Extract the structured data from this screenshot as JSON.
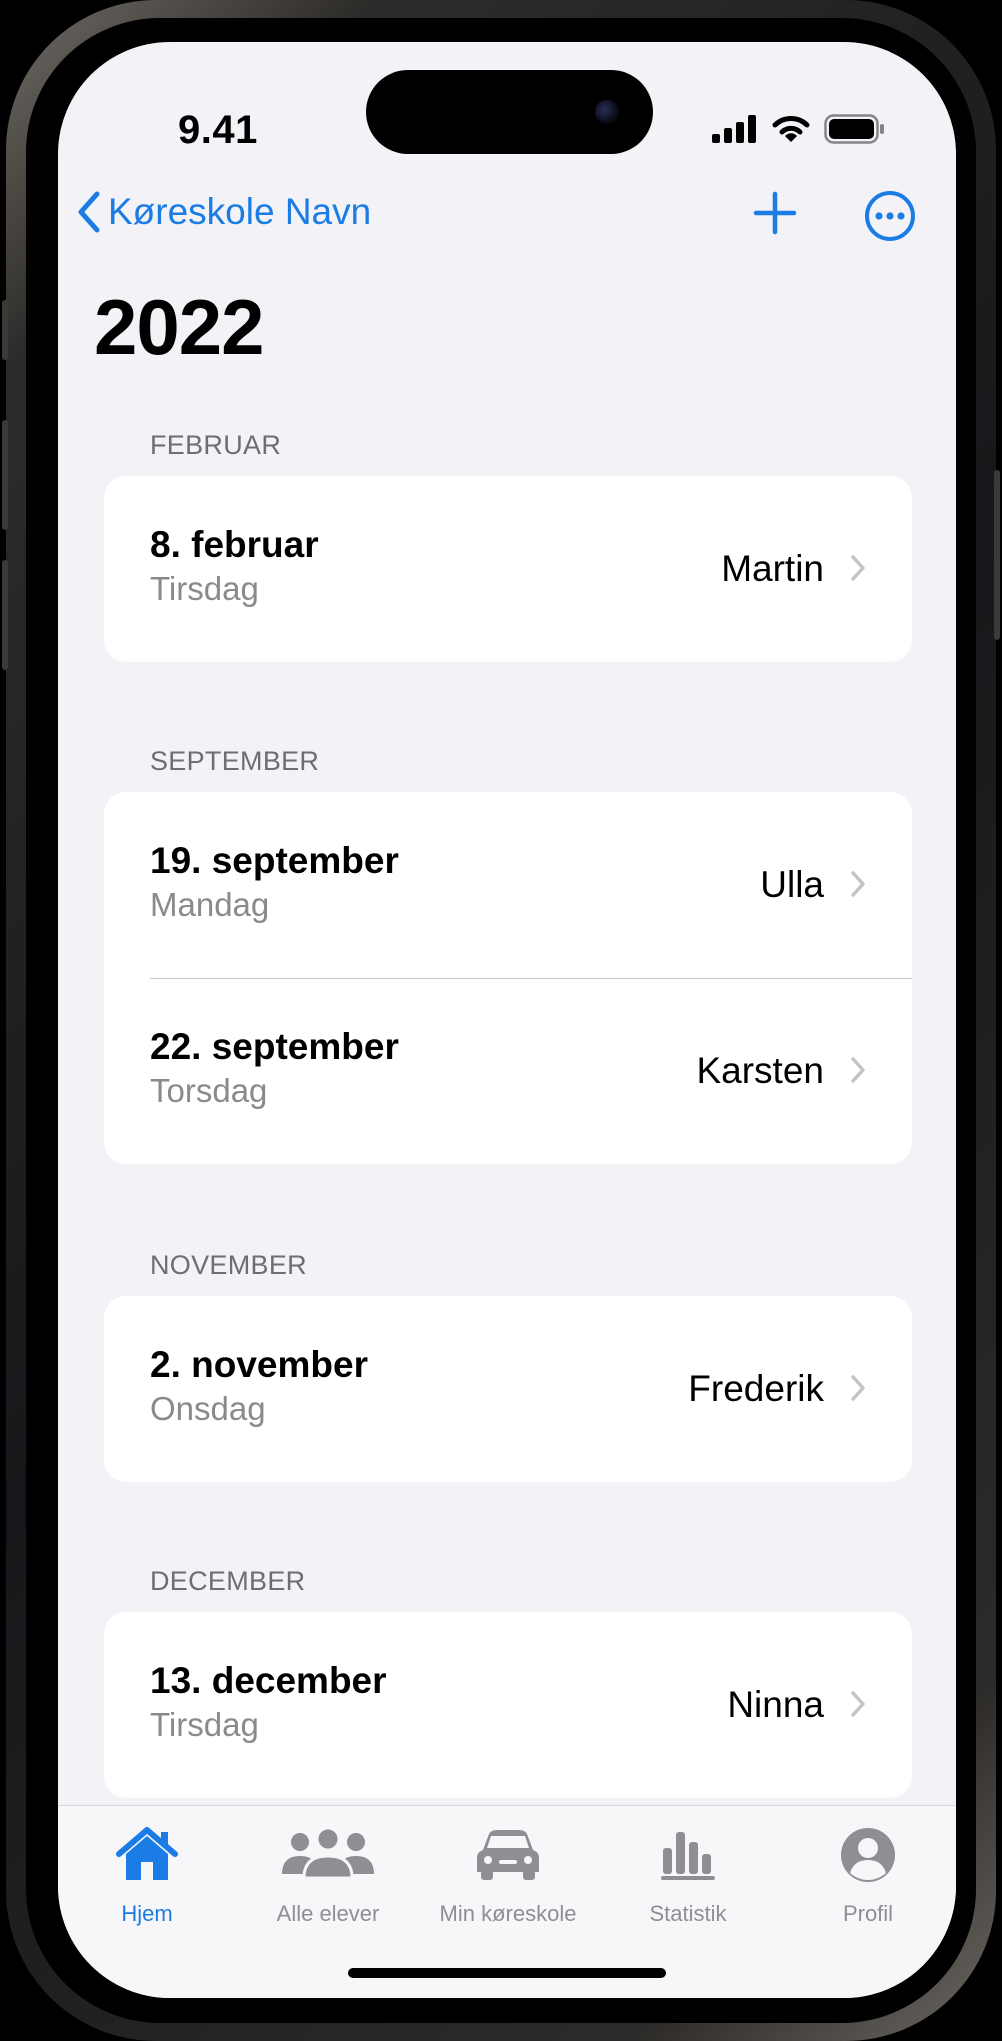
{
  "status_bar": {
    "time": "9.41"
  },
  "nav": {
    "back_label": "Køreskole Navn",
    "back_icon": "chevron-left-icon",
    "add_icon": "plus-icon",
    "more_icon": "ellipsis-circle-icon"
  },
  "title": "2022",
  "sections": [
    {
      "header": "FEBRUAR",
      "rows": [
        {
          "date": "8. februar",
          "day": "Tirsdag",
          "name": "Martin"
        }
      ]
    },
    {
      "header": "SEPTEMBER",
      "rows": [
        {
          "date": "19. september",
          "day": "Mandag",
          "name": "Ulla"
        },
        {
          "date": "22. september",
          "day": "Torsdag",
          "name": "Karsten"
        }
      ]
    },
    {
      "header": "NOVEMBER",
      "rows": [
        {
          "date": "2. november",
          "day": "Onsdag",
          "name": "Frederik"
        }
      ]
    },
    {
      "header": "DECEMBER",
      "rows": [
        {
          "date": "13. december",
          "day": "Tirsdag",
          "name": "Ninna"
        }
      ]
    }
  ],
  "tabbar": {
    "items": [
      {
        "label": "Hjem",
        "icon": "house-icon",
        "active": true
      },
      {
        "label": "Alle elever",
        "icon": "people-icon",
        "active": false
      },
      {
        "label": "Min køreskole",
        "icon": "car-icon",
        "active": false
      },
      {
        "label": "Statistik",
        "icon": "chart-icon",
        "active": false
      },
      {
        "label": "Profil",
        "icon": "person-circle-icon",
        "active": false
      }
    ]
  },
  "colors": {
    "accent": "#1c7ce5",
    "background": "#f2f2f7",
    "secondary_text": "#8a8a8e",
    "inactive_tab": "#8e8e93"
  }
}
